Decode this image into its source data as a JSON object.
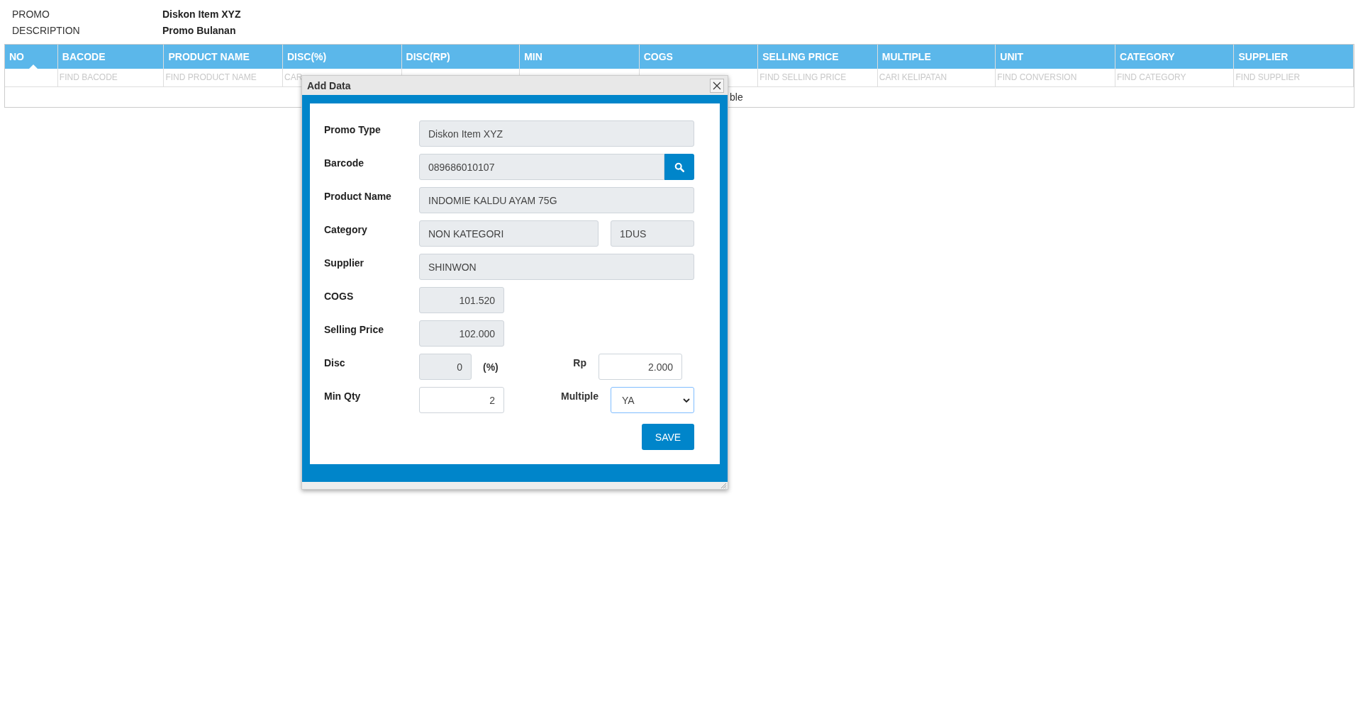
{
  "header": [
    {
      "label": "PROMO",
      "value": "Diskon Item XYZ"
    },
    {
      "label": "DESCRIPTION",
      "value": "Promo Bulanan"
    }
  ],
  "table": {
    "columns": [
      {
        "label": "NO",
        "sorted": true
      },
      {
        "label": "BACODE",
        "sorted": false,
        "placeholder": "FIND BACODE"
      },
      {
        "label": "PRODUCT NAME",
        "sorted": false,
        "placeholder": "FIND PRODUCT NAME"
      },
      {
        "label": "DISC(%)",
        "sorted": false,
        "placeholder": "CAR"
      },
      {
        "label": "DISC(RP)",
        "sorted": false
      },
      {
        "label": "MIN",
        "sorted": false
      },
      {
        "label": "COGS",
        "sorted": false
      },
      {
        "label": "SELLING PRICE",
        "sorted": false,
        "placeholder": "FIND SELLING PRICE"
      },
      {
        "label": "MULTIPLE",
        "sorted": false,
        "placeholder": "CARI KELIPATAN"
      },
      {
        "label": "UNIT",
        "sorted": false,
        "placeholder": "FIND CONVERSION"
      },
      {
        "label": "CATEGORY",
        "sorted": false,
        "placeholder": "FIND CATEGORY"
      },
      {
        "label": "SUPPLIER",
        "sorted": false,
        "placeholder": "FIND SUPPLIER"
      }
    ],
    "empty_message": "ble"
  },
  "dialog": {
    "title": "Add Data",
    "rows": [
      {
        "kind": "text",
        "label": "Promo Type",
        "value": "Diskon Item XYZ",
        "readonly": true
      },
      {
        "kind": "search",
        "label": "Barcode",
        "value": "089686010107",
        "readonly": true
      },
      {
        "kind": "text",
        "label": "Product Name",
        "value": "INDOMIE KALDU AYAM 75G",
        "readonly": true
      },
      {
        "kind": "pair",
        "label": "Category",
        "value": "NON KATEGORI",
        "readonly": true,
        "value2": "1DUS"
      },
      {
        "kind": "text",
        "label": "Supplier",
        "value": "SHINWON",
        "readonly": true
      },
      {
        "kind": "number",
        "label": "COGS",
        "value": "101.520",
        "readonly": true
      },
      {
        "kind": "number",
        "label": "Selling Price",
        "value": "102.000",
        "readonly": true
      },
      {
        "kind": "percent",
        "label": "Disc",
        "value": "0",
        "readonly": true,
        "unit": "(%)",
        "label2": "Rp",
        "value2": "2.000",
        "readonly2": false
      },
      {
        "kind": "select",
        "label": "Min Qty",
        "value": "2",
        "readonly": false,
        "label2": "Multiple",
        "value2": "YA",
        "focused2": true
      }
    ],
    "save_button": "SAVE"
  }
}
